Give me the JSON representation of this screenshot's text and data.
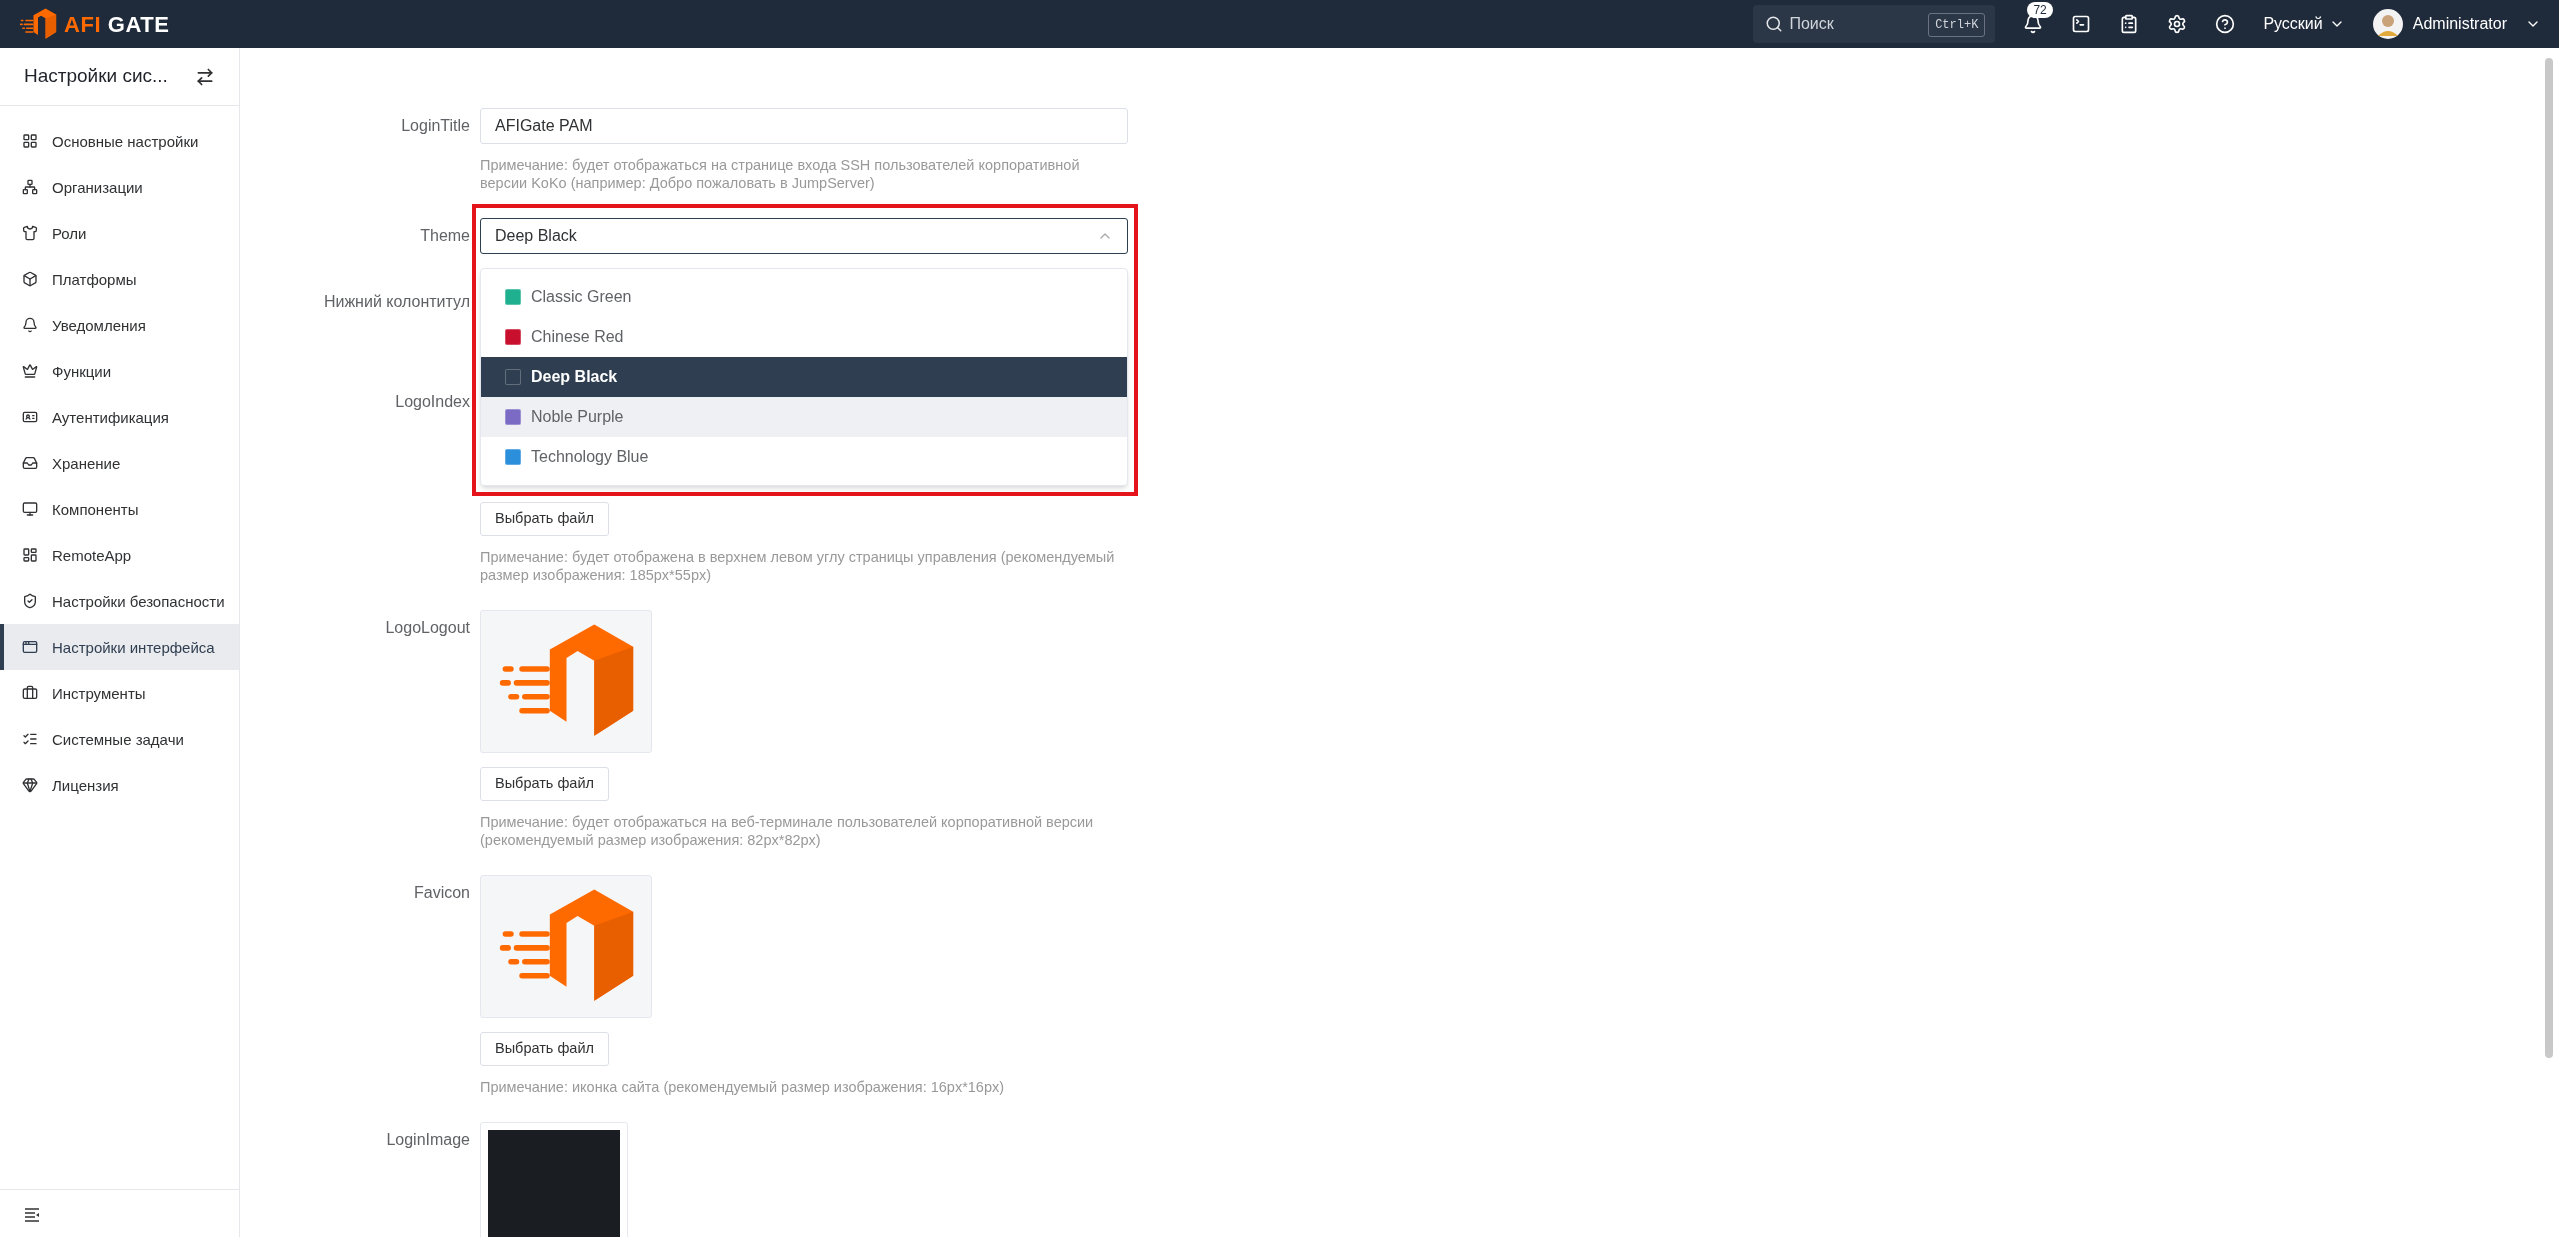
{
  "topbar": {
    "brand": {
      "accent": "AFI",
      "rest": "GATE"
    },
    "search": {
      "placeholder": "Поиск",
      "shortcut": "Ctrl+K"
    },
    "notifications": {
      "count": "72"
    },
    "language": "Русский",
    "user": "Administrator"
  },
  "sidebar": {
    "title": "Настройки сис...",
    "items": [
      {
        "label": "Основные настройки",
        "selected": false
      },
      {
        "label": "Организации",
        "selected": false
      },
      {
        "label": "Роли",
        "selected": false
      },
      {
        "label": "Платформы",
        "selected": false
      },
      {
        "label": "Уведомления",
        "selected": false
      },
      {
        "label": "Функции",
        "selected": false
      },
      {
        "label": "Аутентификация",
        "selected": false
      },
      {
        "label": "Хранение",
        "selected": false
      },
      {
        "label": "Компоненты",
        "selected": false
      },
      {
        "label": "RemoteApp",
        "selected": false
      },
      {
        "label": "Настройки безопасности",
        "selected": false
      },
      {
        "label": "Настройки интерфейса",
        "selected": true
      },
      {
        "label": "Инструменты",
        "selected": false
      },
      {
        "label": "Системные задачи",
        "selected": false
      },
      {
        "label": "Лицензия",
        "selected": false
      }
    ]
  },
  "form": {
    "fields": [
      {
        "kind": "text",
        "label": "LoginTitle",
        "value": "AFIGate PAM",
        "note": "Примечание: будет отображаться на странице входа SSH пользователей корпоративной версии KoKo (например: Добро пожаловать в JumpServer)"
      },
      {
        "kind": "select",
        "label": "Theme",
        "value": "Deep Black",
        "expanded": true,
        "highlighted": true,
        "options": [
          {
            "label": "Classic Green",
            "color": "#1fb18f",
            "selected": false,
            "hovered": false
          },
          {
            "label": "Chinese Red",
            "color": "#c8102e",
            "selected": false,
            "hovered": false
          },
          {
            "label": "Deep Black",
            "color": "#2f3e50",
            "selected": true,
            "hovered": false
          },
          {
            "label": "Noble Purple",
            "color": "#7b6bc4",
            "selected": false,
            "hovered": true
          },
          {
            "label": "Technology Blue",
            "color": "#2b8fdc",
            "selected": false,
            "hovered": false
          }
        ]
      },
      {
        "kind": "covered",
        "label": "Нижний колонтитул"
      },
      {
        "kind": "upload",
        "label": "LogoIndex",
        "button": "Выбрать файл",
        "note": "Примечание: будет отображена в верхнем левом углу страницы управления (рекомендуемый размер изображения: 185px*55px)"
      },
      {
        "kind": "logo_upload",
        "label": "LogoLogout",
        "button": "Выбрать файл",
        "note": "Примечание: будет отображаться на веб-терминале пользователей корпоративной версии (рекомендуемый размер изображения: 82px*82px)"
      },
      {
        "kind": "logo_upload",
        "label": "Favicon",
        "button": "Выбрать файл",
        "note": "Примечание: иконка сайта (рекомендуемый размер изображения: 16px*16px)"
      },
      {
        "kind": "photo_upload",
        "label": "LoginImage"
      }
    ]
  }
}
